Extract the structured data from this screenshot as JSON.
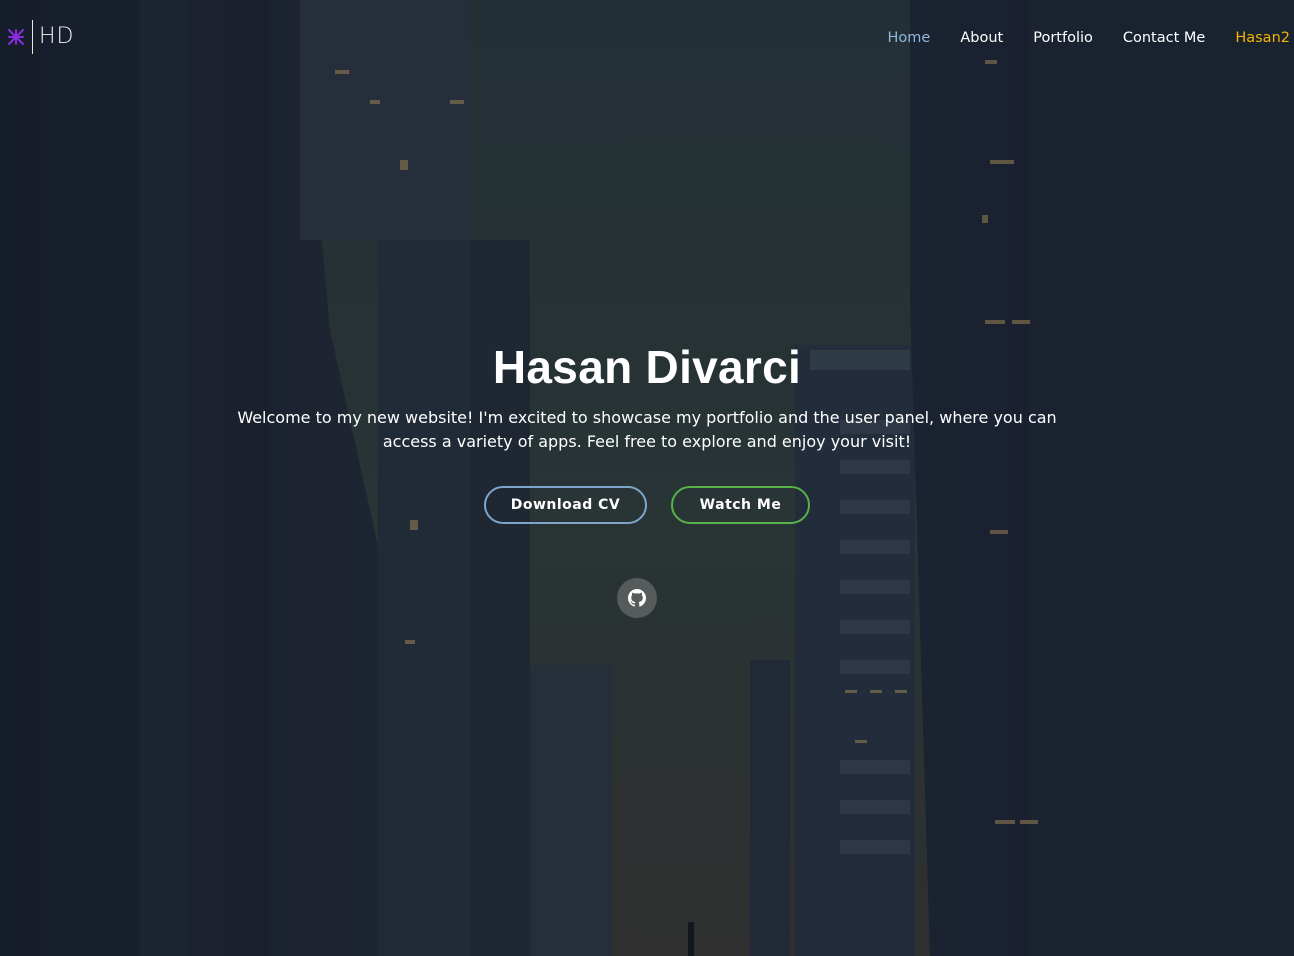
{
  "brand": {
    "logo_text": "HD",
    "mark_color": "#8a2be2"
  },
  "nav": {
    "items": [
      {
        "label": "Home",
        "active": true
      },
      {
        "label": "About"
      },
      {
        "label": "Portfolio"
      },
      {
        "label": "Contact Me"
      },
      {
        "label": "Hasan2",
        "user": true
      }
    ],
    "active_color": "#8fb8df",
    "user_color": "#f4b400"
  },
  "hero": {
    "title": "Hasan Divarci",
    "subtitle": "Welcome to my new website! I'm excited to showcase my portfolio and the user panel, where you can access a variety of apps. Feel free to explore and enjoy your visit!",
    "buttons": {
      "download_cv": "Download CV",
      "watch_me": "Watch Me"
    },
    "download_border": "#7ea6cc",
    "watch_border": "#55b34a"
  },
  "social": {
    "icon": "github-icon"
  }
}
